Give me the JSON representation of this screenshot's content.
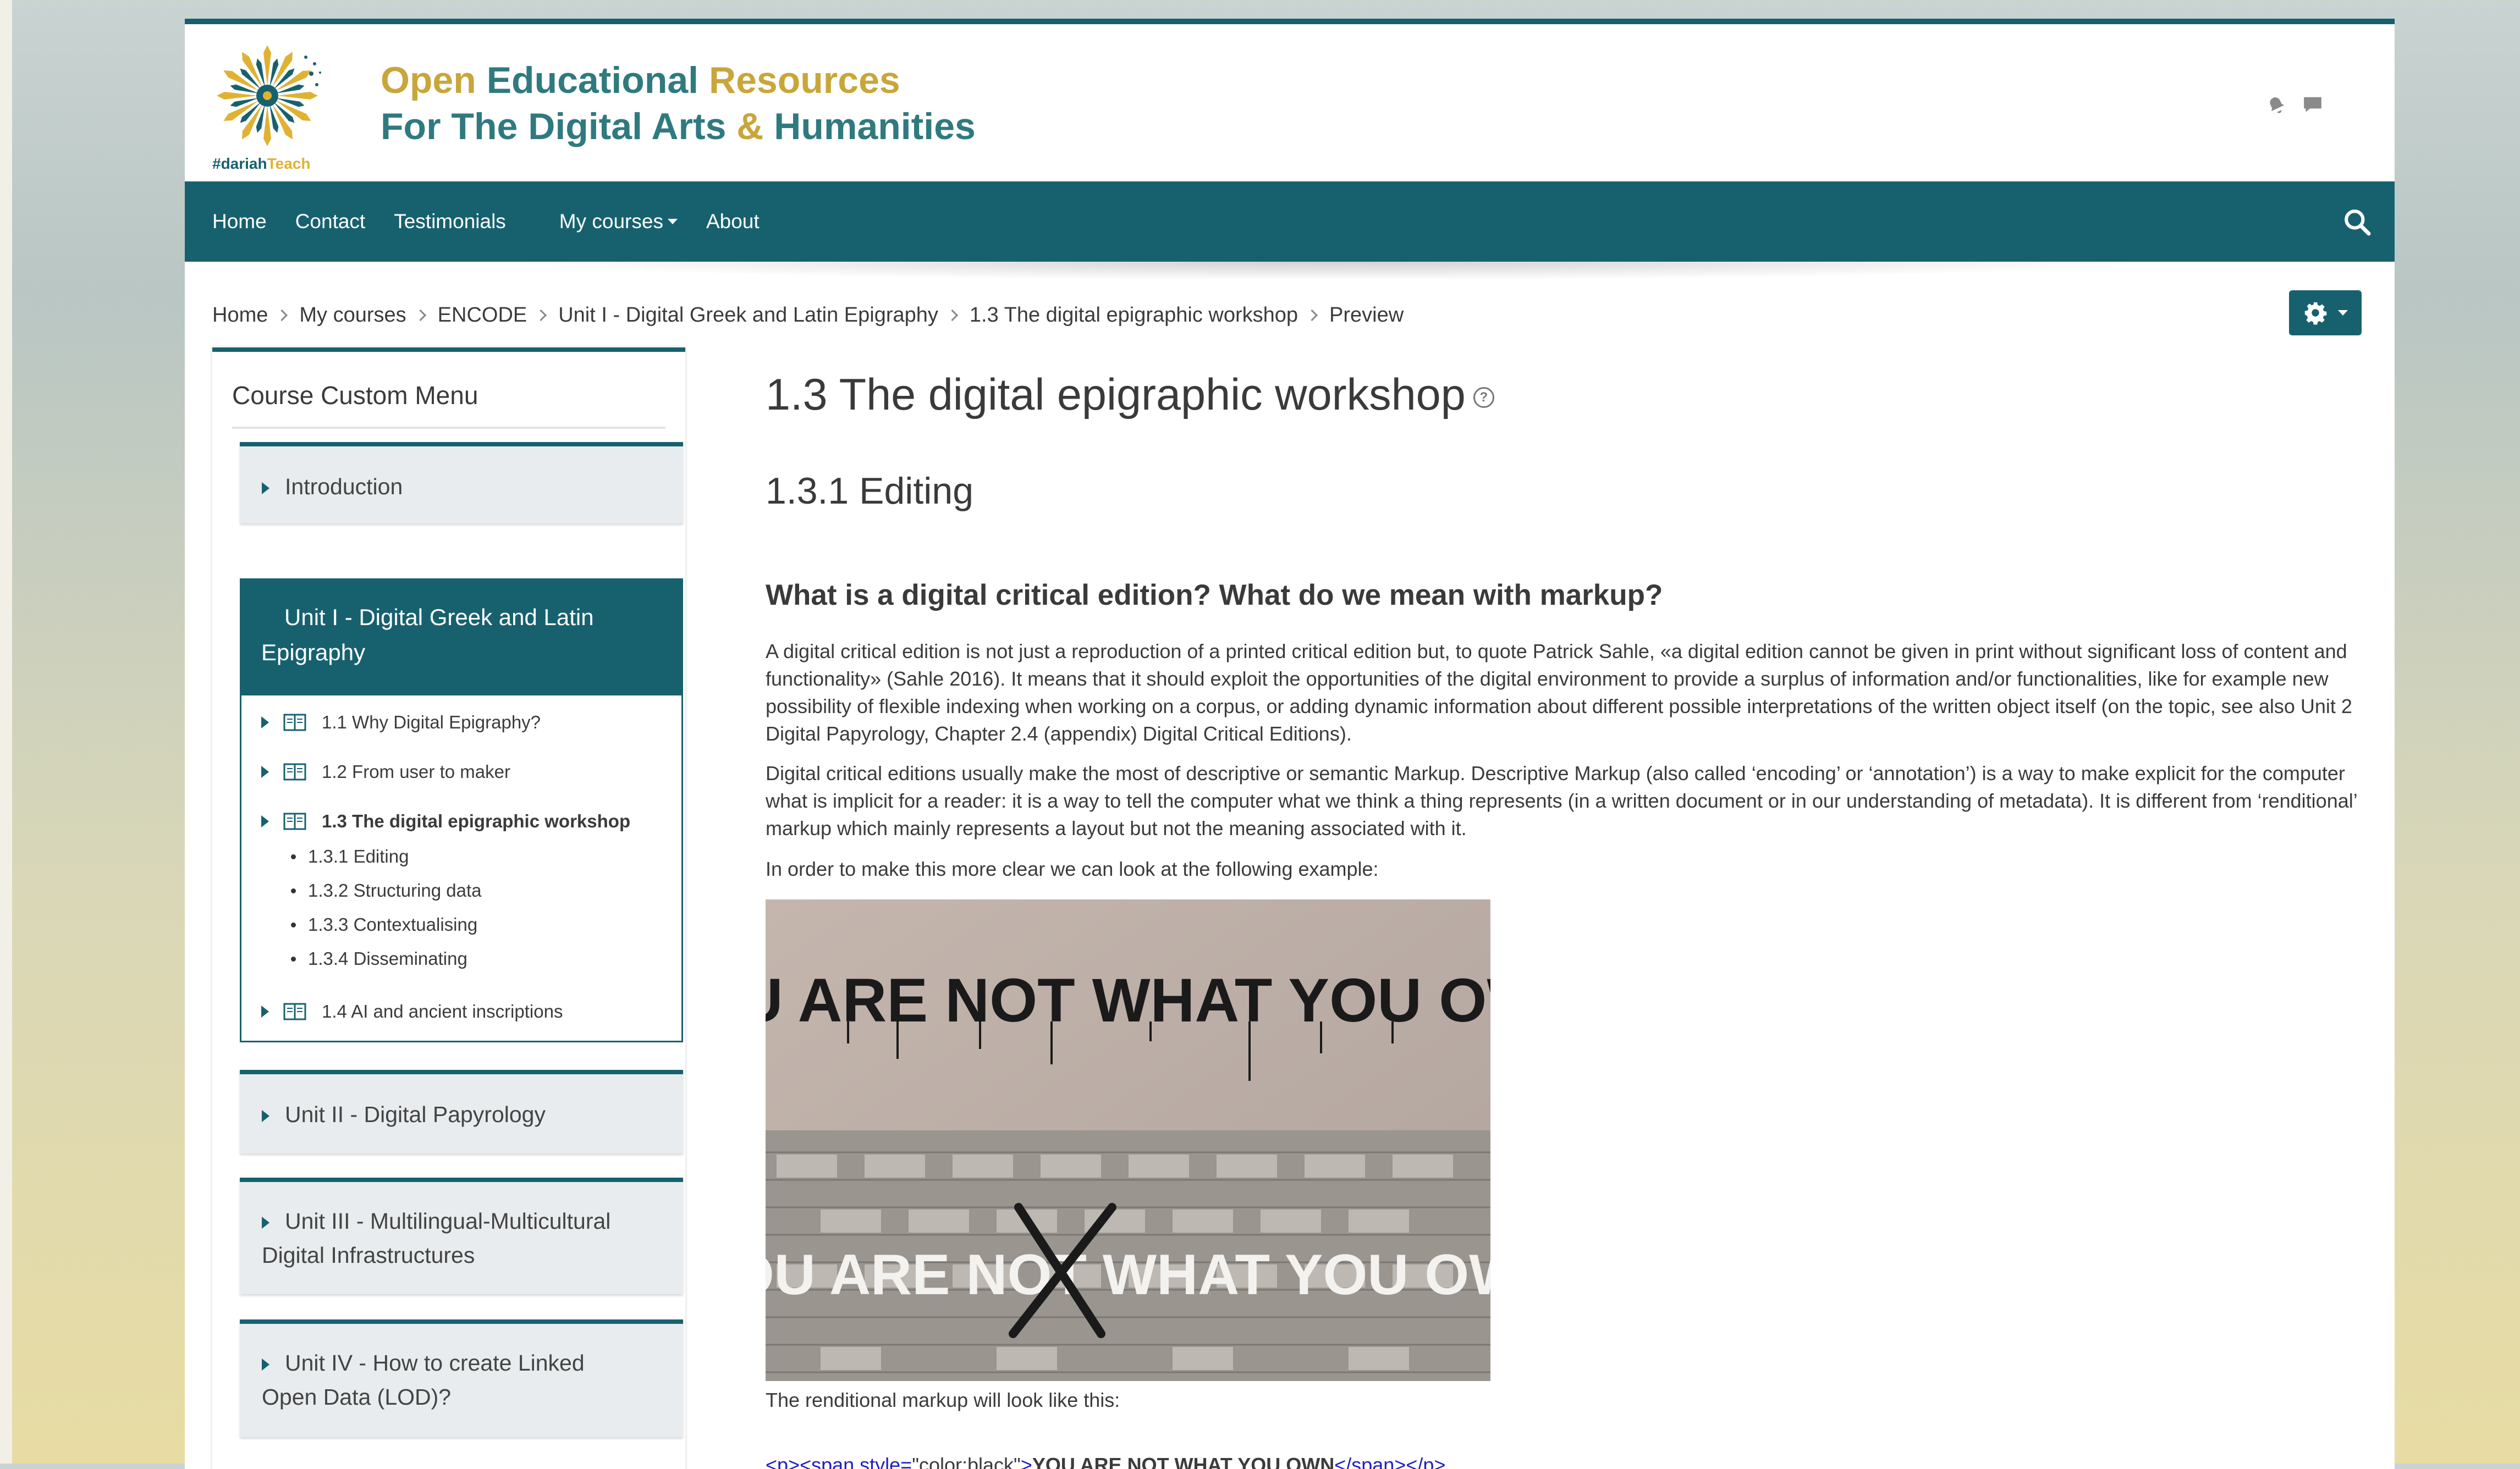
{
  "site": {
    "logo_tag_1": "#dariah",
    "logo_tag_2": "Teach",
    "title_line1_a": "Open ",
    "title_line1_b": "Educational",
    "title_line1_c": " Resources",
    "title_line2_a": "For The Digital Arts ",
    "title_line2_b": "&",
    "title_line2_c": " Humanities"
  },
  "nav": {
    "items": [
      "Home",
      "Contact",
      "Testimonials",
      "My courses",
      "About"
    ]
  },
  "breadcrumb": [
    "Home",
    "My courses",
    "ENCODE",
    "Unit I - Digital Greek and Latin Epigraphy",
    "1.3 The digital epigraphic workshop",
    "Preview"
  ],
  "sidebar": {
    "title": "Course Custom Menu",
    "sections": {
      "intro": "Introduction",
      "unit1_l1": "Unit I - Digital Greek and Latin",
      "unit1_l2": "Epigraphy",
      "unit2": "Unit II - Digital Papyrology",
      "unit3_l1": "Unit III - Multilingual-Multicultural",
      "unit3_l2": "Digital Infrastructures",
      "unit4_l1": "Unit IV - How to create Linked",
      "unit4_l2": "Open Data (LOD)?"
    },
    "lessons": [
      "1.1 Why Digital Epigraphy?",
      "1.2 From user to maker",
      "1.3 The digital epigraphic workshop",
      "1.4 AI and ancient inscriptions"
    ],
    "subitems": [
      "1.3.1 Editing",
      "1.3.2 Structuring data",
      "1.3.3 Contextualising",
      "1.3.4 Disseminating"
    ]
  },
  "main": {
    "title": "1.3 The digital epigraphic workshop",
    "subtitle": "1.3.1 Editing",
    "question": "What is a digital critical edition? What do we mean with markup?",
    "p1": "A digital critical edition is not just a reproduction of a printed critical edition but, to quote Patrick Sahle, «a digital edition cannot be given in print without significant loss of content and functionality» (Sahle 2016). It means that it should exploit the opportunities of the digital environment to provide a surplus of information and/or functionalities, like for example new possibility of flexible indexing when working on a corpus, or adding dynamic information about different possible interpretations of the written object itself (on the topic, see also Unit 2 Digital Papyrology, Chapter 2.4 (appendix) Digital Critical Editions).",
    "p2": "Digital critical editions usually make the most of descriptive or semantic Markup. Descriptive Markup (also called ‘encoding’ or ‘annotation’) is a way to make explicit for the computer what is implicit for a reader: it is a way to tell the computer what we think a thing represents (in a written document or in our understanding of metadata). It is different from ‘renditional’ markup which mainly represents a layout but not the meaning associated with it.",
    "p3": "In order to make this more clear we can look at the following example:",
    "image_top_text": "YOU ARE NOT WHAT YOU OWN.",
    "image_bottom_text": "YOU ARE NOT WHAT YOU OWN",
    "caption": "The renditional markup will look like this:",
    "code": {
      "open": "<p><span style=",
      "style_val": "\"color:black\"",
      "gt": ">",
      "text": "YOU ARE NOT WHAT YOU OWN",
      "close": "</span></p>"
    }
  }
}
